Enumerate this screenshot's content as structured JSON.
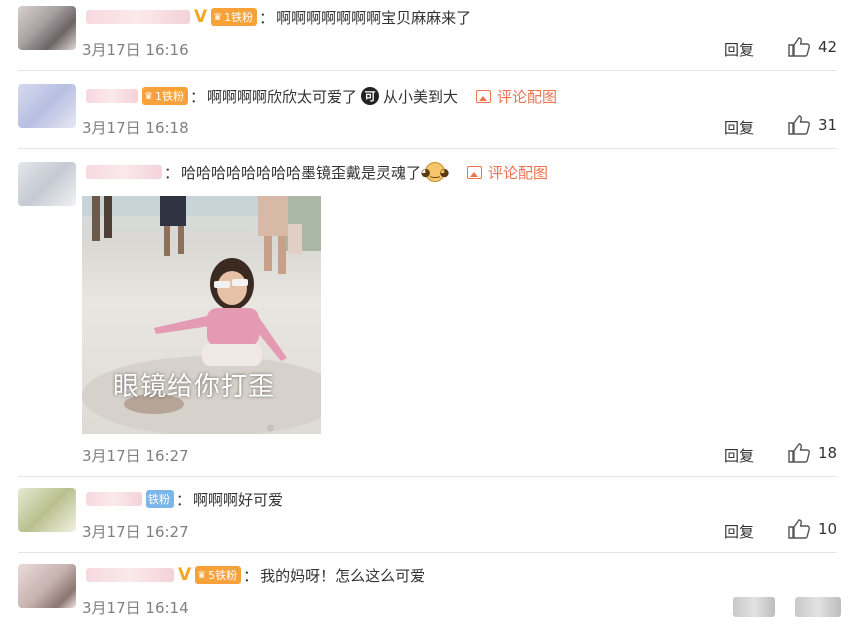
{
  "comments": [
    {
      "username_hidden": true,
      "verified": true,
      "fan_badge": {
        "level": "1",
        "label": "铁粉",
        "color": "#f7a13a"
      },
      "text": "啊啊啊啊啊啊啊宝贝麻麻来了",
      "time": "3月17日 16:16",
      "reply_label": "回复",
      "likes": "42"
    },
    {
      "username_hidden": true,
      "verified": false,
      "fan_badge": {
        "level": "1",
        "label": "铁粉",
        "color": "#f7a13a"
      },
      "text_before": "啊啊啊啊欣欣太可爱了",
      "emoji": "可",
      "text_after": "从小美到大",
      "picture_link": "评论配图",
      "time": "3月17日 16:18",
      "reply_label": "回复",
      "likes": "31"
    },
    {
      "username_hidden": true,
      "verified": false,
      "text": "哈哈哈哈哈哈哈哈墨镜歪戴是灵魂了",
      "emoji": "dog",
      "picture_link": "评论配图",
      "image_caption": "眼镜给你打歪",
      "time": "3月17日 16:27",
      "reply_label": "回复",
      "likes": "18"
    },
    {
      "username_hidden": true,
      "verified": false,
      "fan_badge": {
        "label": "铁粉",
        "color": "#7bb6ea"
      },
      "text": "啊啊啊好可爱",
      "time": "3月17日 16:27",
      "reply_label": "回复",
      "likes": "10"
    },
    {
      "username_hidden": true,
      "verified": true,
      "fan_badge": {
        "level": "5",
        "label": "铁粉",
        "color": "#f7a13a"
      },
      "text": "我的妈呀！怎么这么可爱",
      "time": "3月17日 16:14"
    }
  ],
  "colors": {
    "link": "#eb7350",
    "time": "#808080",
    "separator": "#e6e6e6",
    "verified": "#f5a623"
  }
}
